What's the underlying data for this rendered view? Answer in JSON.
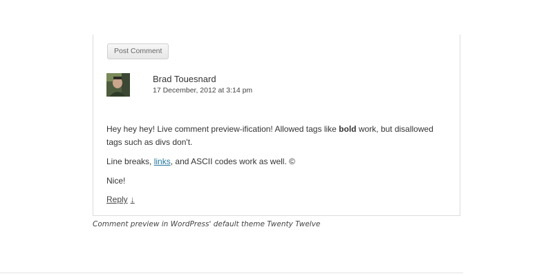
{
  "comment_form": {
    "submit_label": "Post Comment"
  },
  "comment": {
    "author": "Brad Touesnard",
    "timestamp": "17 December, 2012 at 3:14 pm",
    "paragraph1_before": "Hey hey hey! Live comment preview-ification! Allowed tags like ",
    "paragraph1_bold": "bold",
    "paragraph1_after": " work, but disallowed tags such as divs don't.",
    "paragraph2_before": "Line breaks, ",
    "paragraph2_link": "links",
    "paragraph2_after": ", and ASCII codes work as well. ©",
    "paragraph3": "Nice!",
    "reply_label": "Reply",
    "reply_arrow": "↓"
  },
  "figure": {
    "caption": "Comment preview in WordPress' default theme Twenty Twelve"
  },
  "colors": {
    "link": "#21759b",
    "text": "#333333",
    "border": "#dcdcdc"
  },
  "icons": {
    "reply_arrow": "down-arrow-icon"
  }
}
